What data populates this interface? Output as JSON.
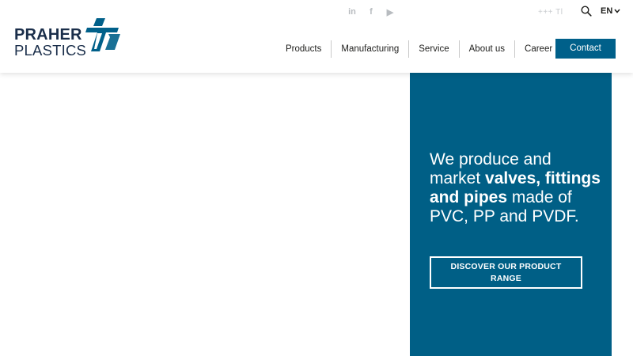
{
  "brand": {
    "name_line1": "PRAHER",
    "name_line2": "PLASTICS",
    "color_dark": "#1a2e4a",
    "color_accent": "#00608a"
  },
  "topbar": {
    "social": [
      {
        "icon": "linkedin-icon",
        "glyph": "in"
      },
      {
        "icon": "facebook-icon",
        "glyph": "f"
      },
      {
        "icon": "youtube-icon",
        "glyph": "▶"
      }
    ],
    "phone": "+++ Tl",
    "search_icon": "search-icon",
    "language": "EN"
  },
  "nav": {
    "items": [
      "Products",
      "Manufacturing",
      "Service",
      "About us",
      "Career"
    ],
    "contact_label": "Contact"
  },
  "hero": {
    "text_pre": "We produce and market ",
    "text_bold": "valves, fittings and pipes",
    "text_post": " made of PVC, PP and PVDF.",
    "cta_label": "DISCOVER OUR PRODUCT RANGE",
    "panel_color": "#005f86"
  }
}
